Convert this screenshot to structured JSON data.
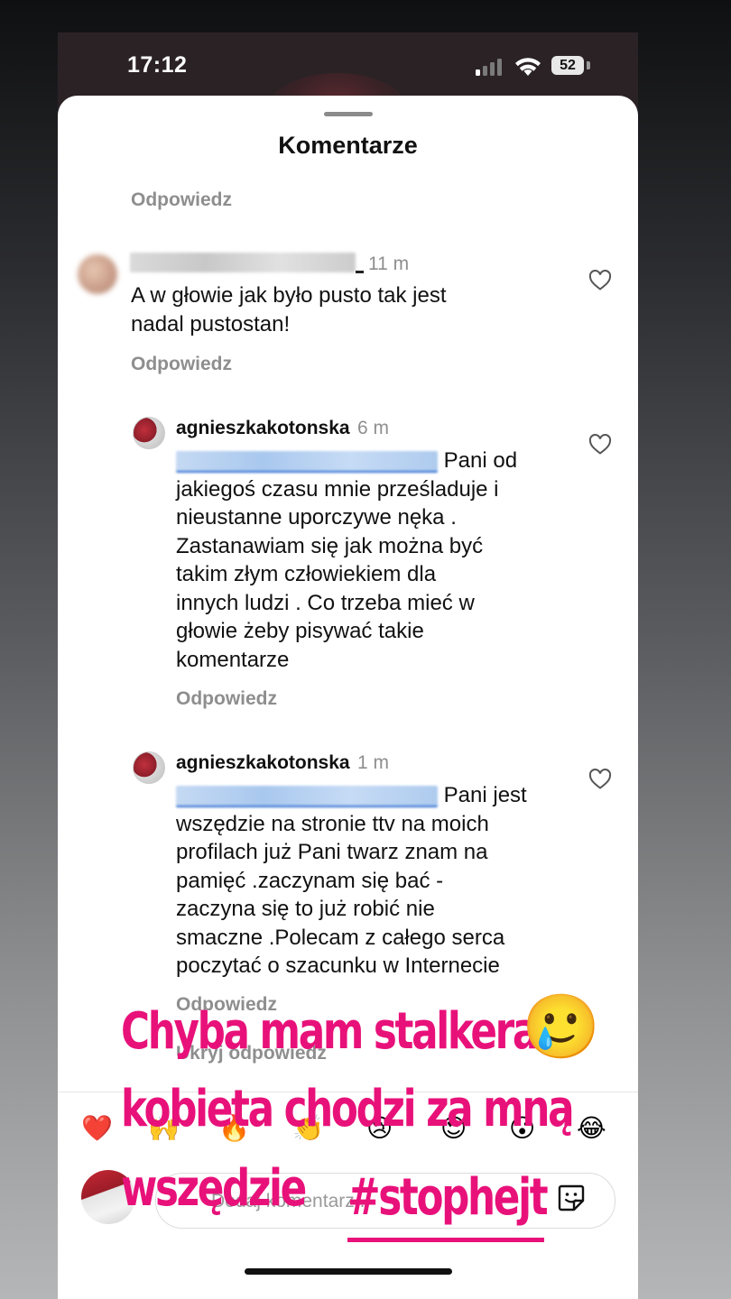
{
  "status_bar": {
    "time": "17:12",
    "battery": "52"
  },
  "sheet": {
    "title": "Komentarze"
  },
  "top_reply": "Odpowiedz",
  "comments": [
    {
      "time": "11 m",
      "text_lines": [
        "A w głowie jak było pusto tak jest",
        "nadal pustostan!"
      ],
      "reply": "Odpowiedz"
    },
    {
      "username": "agnieszkakotonska",
      "time": "6 m",
      "first_line": "Pani od",
      "text_lines": [
        "jakiegoś czasu mnie prześladuje i",
        "nieustanne uporczywe nęka .",
        "Zastanawiam się jak można być",
        "takim złym człowiekiem dla",
        "innych ludzi . Co trzeba mieć w",
        "głowie żeby pisywać takie",
        "komentarze"
      ],
      "reply": "Odpowiedz"
    },
    {
      "username": "agnieszkakotonska",
      "time": "1 m",
      "first_line": "Pani jest",
      "text_lines": [
        "wszędzie na stronie ttv na moich",
        "profilach już Pani twarz znam na",
        "pamięć .zaczynam się bać -",
        "zaczyna się to już robić nie",
        "smaczne .Polecam z całego serca",
        "poczytać o szacunku w Internecie"
      ],
      "reply": "Odpowiedz"
    }
  ],
  "partial_reply": "Ukryj odpowiedz",
  "emoji_bar": [
    "❤️",
    "🙌",
    "🔥",
    "👏",
    "😢",
    "😍",
    "😮",
    "😂"
  ],
  "comment_input": {
    "placeholder": "Dodaj komentarz..."
  },
  "overlay": {
    "line1": "Chyba mam stalkera",
    "line1_emoji": "🥲",
    "line2": "kobieta chodzi za mną",
    "line3": "wszędzie",
    "hashtag": "#stophejt",
    "color": "#e8117a"
  }
}
